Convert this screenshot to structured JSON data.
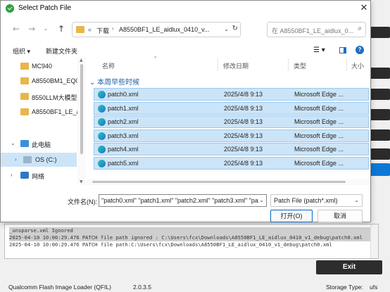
{
  "dialog": {
    "title": "Select Patch File",
    "close": "✕"
  },
  "nav": {
    "back": "←",
    "forward": "→",
    "recent": "⌄",
    "up": "↑",
    "address": {
      "overflow": "«",
      "crumbs": [
        "下载",
        "A8550BF1_LE_aidlux_0410_v..."
      ],
      "dropdown": "⌄",
      "refresh": "↻"
    },
    "search_placeholder": "在 A8550BF1_LE_aidlux_0...",
    "search_icon": "⌕"
  },
  "toolbar": {
    "organize": "组织 ▾",
    "new_folder": "新建文件夹",
    "view_icon": "☰ ▾",
    "help": "?"
  },
  "nav_pane": {
    "items": [
      {
        "label": "MC940",
        "icon": "folder-icon"
      },
      {
        "label": "A8550BM1_EQ0(",
        "icon": "folder-icon"
      },
      {
        "label": "8550LLM大模型工",
        "icon": "folder-icon"
      },
      {
        "label": "A8550BF1_LE_aid",
        "icon": "folder-icon"
      },
      {
        "label": "此电脑",
        "icon": "pc-icon"
      },
      {
        "label": "OS (C:)",
        "icon": "drive-icon"
      },
      {
        "label": "网络",
        "icon": "network-icon"
      }
    ]
  },
  "file_list": {
    "columns": {
      "name": "名称",
      "date": "修改日期",
      "type": "类型",
      "size": "大小"
    },
    "sort_indicator": "^",
    "group": "本周早些时候",
    "files": [
      {
        "name": "patch0.xml",
        "date": "2025/4/8 9:13",
        "type": "Microsoft Edge ..."
      },
      {
        "name": "patch1.xml",
        "date": "2025/4/8 9:13",
        "type": "Microsoft Edge ..."
      },
      {
        "name": "patch2.xml",
        "date": "2025/4/8 9:13",
        "type": "Microsoft Edge ..."
      },
      {
        "name": "patch3.xml",
        "date": "2025/4/8 9:13",
        "type": "Microsoft Edge ..."
      },
      {
        "name": "patch4.xml",
        "date": "2025/4/8 9:13",
        "type": "Microsoft Edge ..."
      },
      {
        "name": "patch5.xml",
        "date": "2025/4/8 9:13",
        "type": "Microsoft Edge ..."
      }
    ]
  },
  "bottom": {
    "filename_label": "文件名(N):",
    "filename_value": "\"patch0.xml\" \"patch1.xml\" \"patch2.xml\" \"patch3.xml\" \"pa",
    "filter_value": "Patch File (patch*.xml)",
    "open": "打开(O)",
    "cancel": "取消"
  },
  "app": {
    "log_lines": [
      "_unsparse.xml Ignored",
      "2025-04-10 10:00:29.476    PATCH file path ignored : C:\\Users\\fcx\\Downloads\\A8550BF1_LE_aidlux_0410_v1_debug\\patch0.xml",
      "2025-04-10 10:00:29.476    PATCH file path:C:\\Users\\fcx\\Downloads\\A8550BF1_LE_aidlux_0410_v1_debug\\patch0.xml"
    ],
    "exit": "Exit",
    "status_app": "Qualcomm Flash Image Loader (QFIL)",
    "status_version": "2.0.3.5",
    "status_storage_label": "Storage Type:",
    "status_storage_value": "ufs"
  }
}
